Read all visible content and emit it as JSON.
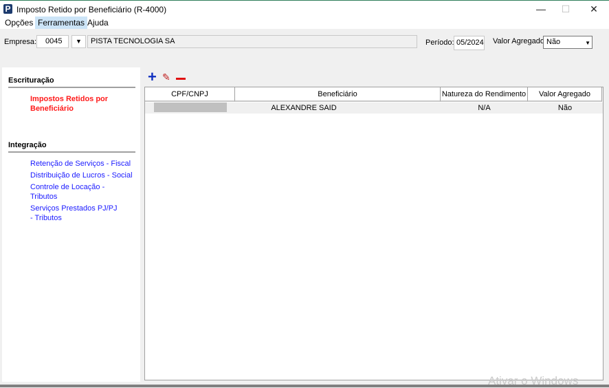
{
  "window": {
    "title": "Imposto Retido por Beneficiário (R-4000)",
    "app_icon": "P"
  },
  "menu": [
    "Opções",
    "Ferramentas",
    "Ajuda"
  ],
  "filters": {
    "empresa_label": "Empresa:",
    "empresa_code": "0045",
    "empresa_name": "PISTA TECNOLOGIA SA",
    "periodo_label": "Período:",
    "periodo_value": "05/2024",
    "valor_agregado_label": "Valor Agregado:",
    "valor_agregado_value": "Não"
  },
  "sidebar": {
    "sections": [
      {
        "title": "Escrituração",
        "items": [
          {
            "label": "Impostos Retidos por Beneficiário",
            "active": true
          }
        ]
      },
      {
        "title": "Integração",
        "items": [
          {
            "label": "Retenção de Serviços - Fiscal"
          },
          {
            "label": "Distribuição de Lucros - Social"
          },
          {
            "label": "Controle de Locação - Tributos"
          },
          {
            "label": "Serviços Prestados PJ/PJ - Tributos"
          }
        ]
      }
    ]
  },
  "grid": {
    "columns": [
      "CPF/CNPJ",
      "Beneficiário",
      "Natureza do Rendimento",
      "Valor Agregado"
    ],
    "rows": [
      {
        "cpf": "",
        "beneficiario": "ALEXANDRE SAID",
        "natureza": "N/A",
        "valor_agregado": "Não"
      }
    ]
  },
  "watermark": "Ativar o Windows"
}
